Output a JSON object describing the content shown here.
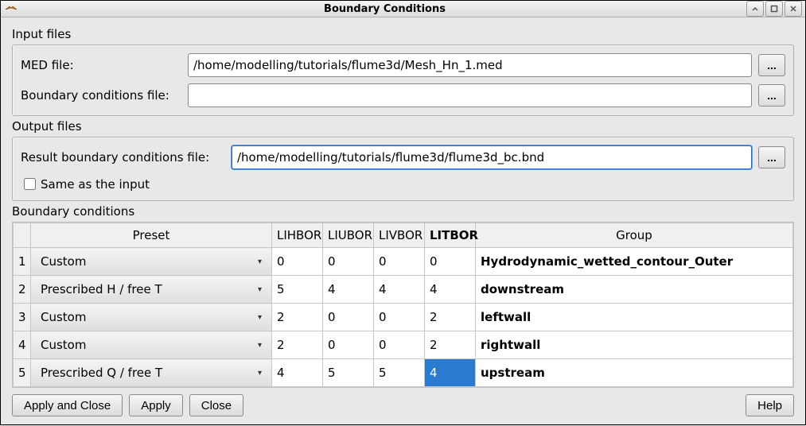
{
  "window": {
    "title": "Boundary Conditions"
  },
  "input_files": {
    "label": "Input files",
    "med_file": {
      "label": "MED file:",
      "value": "/home/modelling/tutorials/flume3d/Mesh_Hn_1.med"
    },
    "bc_file": {
      "label": "Boundary conditions file:",
      "value": ""
    }
  },
  "output_files": {
    "label": "Output files",
    "result_file": {
      "label": "Result boundary conditions file:",
      "value": "/home/modelling/tutorials/flume3d/flume3d_bc.bnd"
    },
    "same_as_input": {
      "label": "Same as the input",
      "checked": false
    }
  },
  "table": {
    "label": "Boundary conditions",
    "headers": {
      "preset": "Preset",
      "lihbor": "LIHBOR",
      "liubor": "LIUBOR",
      "livbor": "LIVBOR",
      "litbor": "LITBOR",
      "group": "Group"
    },
    "rows": [
      {
        "n": "1",
        "preset": "Custom",
        "lihbor": "0",
        "liubor": "0",
        "livbor": "0",
        "litbor": "0",
        "group": "Hydrodynamic_wetted_contour_Outer"
      },
      {
        "n": "2",
        "preset": "Prescribed H / free T",
        "lihbor": "5",
        "liubor": "4",
        "livbor": "4",
        "litbor": "4",
        "group": "downstream"
      },
      {
        "n": "3",
        "preset": "Custom",
        "lihbor": "2",
        "liubor": "0",
        "livbor": "0",
        "litbor": "2",
        "group": "leftwall"
      },
      {
        "n": "4",
        "preset": "Custom",
        "lihbor": "2",
        "liubor": "0",
        "livbor": "0",
        "litbor": "2",
        "group": "rightwall"
      },
      {
        "n": "5",
        "preset": "Prescribed Q / free T",
        "lihbor": "4",
        "liubor": "5",
        "livbor": "5",
        "litbor": "4",
        "group": "upstream"
      }
    ],
    "selected_cell": {
      "row": 5,
      "col": "litbor"
    }
  },
  "buttons": {
    "apply_close": "Apply and Close",
    "apply": "Apply",
    "close": "Close",
    "help": "Help",
    "browse": "..."
  }
}
